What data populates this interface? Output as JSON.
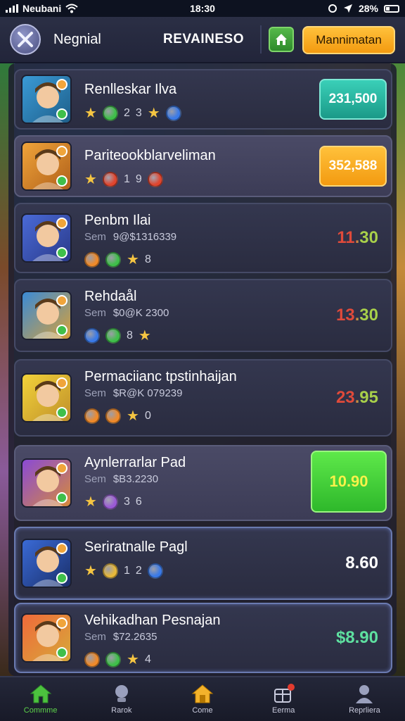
{
  "status_bar": {
    "carrier": "Neubani",
    "time": "18:30",
    "battery": "28%"
  },
  "header": {
    "title": "Negnial",
    "section": "REVAINESO",
    "action_label": "Mannimatan",
    "home_icon": "home-icon",
    "menu_icon": "swords-icon"
  },
  "items": [
    {
      "name": "Renlleskar Ilva",
      "sub_label": "",
      "sub_value": "",
      "icons": [
        "star",
        "green-coin",
        "2",
        "3",
        "star",
        "blue-coin"
      ],
      "price": "231,500",
      "price_style": "teal-button"
    },
    {
      "name": "Pariteookblarveliman",
      "sub_label": "",
      "sub_value": "",
      "icons": [
        "star",
        "red-coin",
        "1",
        "9",
        "red-coin"
      ],
      "price": "352,588",
      "price_style": "orange-button"
    },
    {
      "name": "Penbm Ilai",
      "sub_label": "Sem",
      "sub_value": "9@$1316339",
      "icons": [
        "orange-coin",
        "green-coin",
        "star",
        "8"
      ],
      "price": "11.30",
      "price_style": "text-red-green"
    },
    {
      "name": "Rehdaål",
      "sub_label": "Sem",
      "sub_value": "$0@K 2300",
      "icons": [
        "blue-coin",
        "green-coin",
        "8",
        "star"
      ],
      "price": "13.30",
      "price_style": "text-red-green"
    },
    {
      "name": "Permaciianc tpstinhaijan",
      "sub_label": "Sem",
      "sub_value": "$R@K 079239",
      "icons": [
        "orange-coin",
        "orange-coin",
        "star",
        "0"
      ],
      "price": "23.95",
      "price_style": "text-red-green"
    },
    {
      "name": "Aynlerrarlar Pad",
      "sub_label": "Sem",
      "sub_value": "$B3.2230",
      "icons": [
        "star",
        "purple-coin",
        "3",
        "6"
      ],
      "price": "10.90",
      "price_style": "green-button"
    },
    {
      "name": "Seriratnalle Pagl",
      "sub_label": "",
      "sub_value": "",
      "icons": [
        "star",
        "gold-coin",
        "1",
        "2",
        "blue-coin"
      ],
      "price": "8.60",
      "price_style": "text-white"
    },
    {
      "name": "Vehikadhan Pesnajan",
      "sub_label": "Sem",
      "sub_value": "$72.2635",
      "icons": [
        "orange-coin",
        "green-coin",
        "star",
        "4"
      ],
      "price": "$8.90",
      "price_style": "text-green"
    }
  ],
  "nav": [
    {
      "label": "Commme",
      "icon": "home-icon",
      "active": true
    },
    {
      "label": "Rarok",
      "icon": "trophy-icon",
      "active": false
    },
    {
      "label": "Come",
      "icon": "shop-icon",
      "active": false
    },
    {
      "label": "Eerma",
      "icon": "gift-icon",
      "active": false
    },
    {
      "label": "Reprliera",
      "icon": "profile-icon",
      "active": false
    }
  ]
}
